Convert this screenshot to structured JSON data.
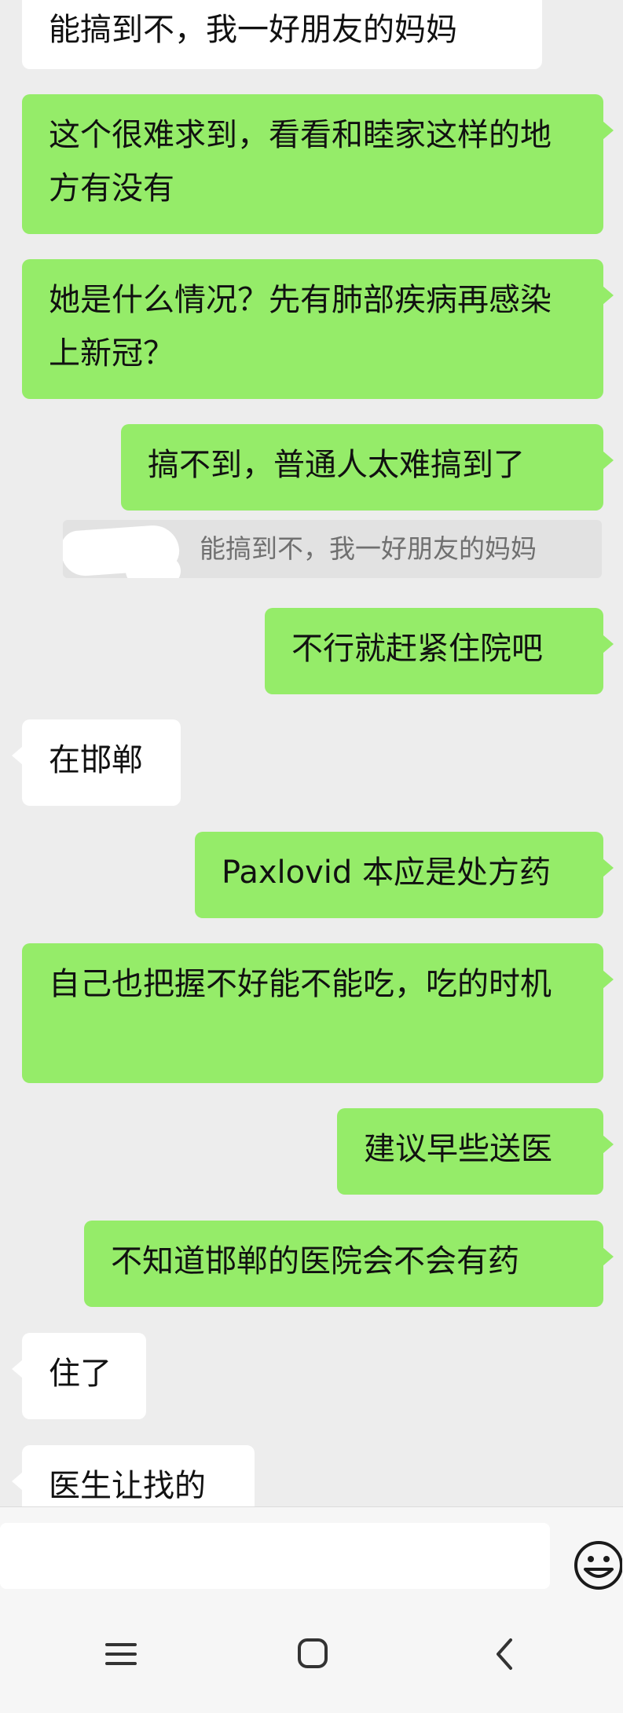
{
  "messages": [
    {
      "from": "them",
      "text": "能搞到不，我一好朋友的妈妈"
    },
    {
      "from": "me",
      "text": "这个很难求到，看看和睦家这样的地方有没有"
    },
    {
      "from": "me",
      "text": "她是什么情况？先有肺部疾病再感染上新冠？"
    },
    {
      "from": "me",
      "text": "搞不到，普通人太难搞到了"
    },
    {
      "from": "me",
      "text": "不行就赶紧住院吧"
    },
    {
      "from": "them",
      "text": "在邯郸"
    },
    {
      "from": "me",
      "text": "Paxlovid 本应是处方药"
    },
    {
      "from": "me",
      "text": "自己也把握不好能不能吃，吃的时机"
    },
    {
      "from": "me",
      "text": "建议早些送医"
    },
    {
      "from": "me",
      "text": "不知道邯郸的医院会不会有药"
    },
    {
      "from": "them",
      "text": "住了"
    },
    {
      "from": "them",
      "text": "医生让找的"
    }
  ],
  "quote": {
    "text": "能搞到不，我一好朋友的妈妈"
  },
  "input": {
    "icon": "emoji-icon"
  },
  "nav": {
    "icons": [
      "menu-icon",
      "home-icon",
      "back-icon"
    ]
  }
}
